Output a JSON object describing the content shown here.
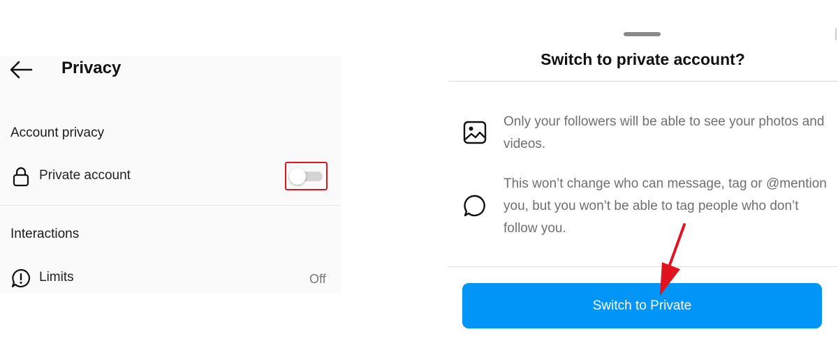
{
  "privacy": {
    "title": "Privacy",
    "back_icon": "arrow-left-icon",
    "account_privacy": {
      "section_title": "Account privacy",
      "private_account": {
        "label": "Private account",
        "icon": "lock-icon",
        "toggle_on": false
      }
    },
    "interactions": {
      "section_title": "Interactions",
      "limits": {
        "label": "Limits",
        "icon": "alert-bubble-icon",
        "value": "Off"
      }
    }
  },
  "dialog": {
    "title": "Switch to private account?",
    "items": [
      {
        "icon": "image-icon",
        "text": "Only your followers will be able to see your photos and videos."
      },
      {
        "icon": "chat-bubble-icon",
        "text": "This won’t change who can message, tag or @mention you, but you won’t be able to tag people who don’t follow you."
      }
    ],
    "confirm_label": "Switch to Private"
  },
  "colors": {
    "accent_blue": "#0095f6",
    "highlight_red": "#e0141e",
    "annotation_arrow": "#e0141e",
    "toggle_off_track": "#d4d4d4",
    "muted_text": "#6f6f6f"
  }
}
